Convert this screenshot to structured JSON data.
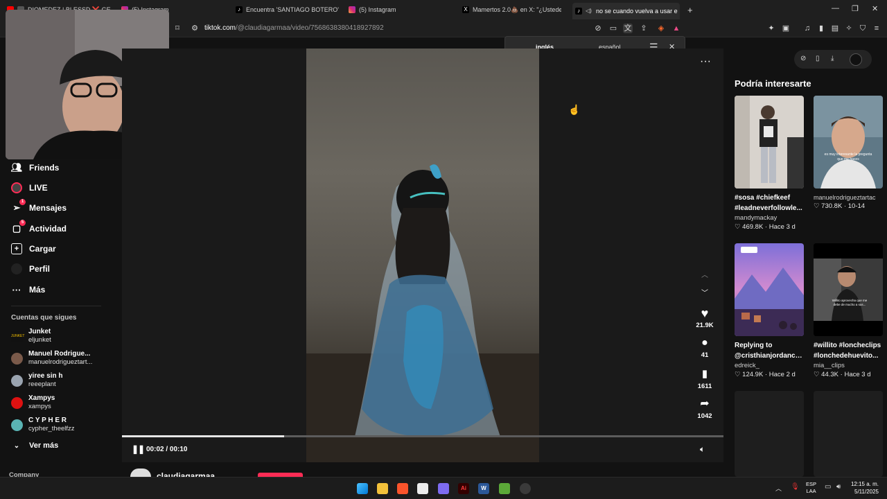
{
  "browser": {
    "tabs": [
      {
        "label": "DIOMEDEZ | BLESSD ❌ GEEZ...",
        "active": false
      },
      {
        "label": "(5) Instagram",
        "active": false
      },
      {
        "label": "Encuentra 'SANTIAGO BOTERO' en Ti",
        "active": false
      },
      {
        "label": "(5) Instagram",
        "active": false
      },
      {
        "label": "Mamertos 2.0💩 en X: \"¿Ustedes se",
        "active": false
      },
      {
        "label": "no se cuando vuelva a usar e",
        "active": true
      }
    ],
    "new_tab": "+",
    "url_host": "tiktok.com",
    "url_path": "/@claudiagarmaa/video/7568638380418927892"
  },
  "translate": {
    "from": "inglés",
    "to": "español"
  },
  "sidebar": {
    "nav": [
      {
        "label": "Friends",
        "icon": "friends-icon"
      },
      {
        "label": "LIVE",
        "icon": "live-icon"
      },
      {
        "label": "Mensajes",
        "icon": "messages-icon",
        "badge": "1"
      },
      {
        "label": "Actividad",
        "icon": "activity-icon",
        "badge": "5"
      },
      {
        "label": "Cargar",
        "icon": "upload-icon"
      },
      {
        "label": "Perfil",
        "icon": "profile-icon"
      },
      {
        "label": "Más",
        "icon": "more-icon"
      }
    ],
    "following_title": "Cuentas que sigues",
    "following": [
      {
        "name": "Junket",
        "handle": "eljunket"
      },
      {
        "name": "Manuel Rodrigue...",
        "handle": "manuelrodrigueztart..."
      },
      {
        "name": "yiree sin h",
        "handle": "reeeplant"
      },
      {
        "name": "Xampys",
        "handle": "xampys"
      },
      {
        "name": "C Y P H E R",
        "handle": "cypher_theelfzz"
      }
    ],
    "see_more": "Ver más",
    "company": "Company"
  },
  "video": {
    "time": "00:02 / 00:10",
    "progress": 0.27,
    "username": "claudiagarmaa",
    "likes": "21.9K",
    "comments": "41",
    "saves": "1611",
    "shares": "1042"
  },
  "recommendations": {
    "title": "Podría interesarte",
    "items": [
      {
        "caption": "#sosa #chiefkeef #leadneverfollowle...",
        "author": "mandymackay",
        "likes": "469.8K",
        "date": "Hace 3 d"
      },
      {
        "caption": "",
        "author": "manuelrodrigueztartac",
        "likes": "730.8K",
        "date": "10-14"
      },
      {
        "caption": "Replying to @cristhianjordanch...",
        "author": "edreick_",
        "likes": "124.9K",
        "date": "Hace 2 d"
      },
      {
        "caption": "#willito #loncheclips #lonchedehuevito...",
        "author": "mia__clips",
        "likes": "44.3K",
        "date": "Hace 3 d"
      }
    ],
    "thumb_text_2": "es muy interesante la pregunta que me haces",
    "thumb_text_4": "Willito aprovecha que me debe de mucho a sus..."
  },
  "taskbar": {
    "lang_1": "ESP",
    "lang_2": "LAA",
    "time": "12:15 a. m.",
    "date": "5/11/2025"
  },
  "colors": {
    "accent": "#fe2c55",
    "bg": "#121212"
  }
}
